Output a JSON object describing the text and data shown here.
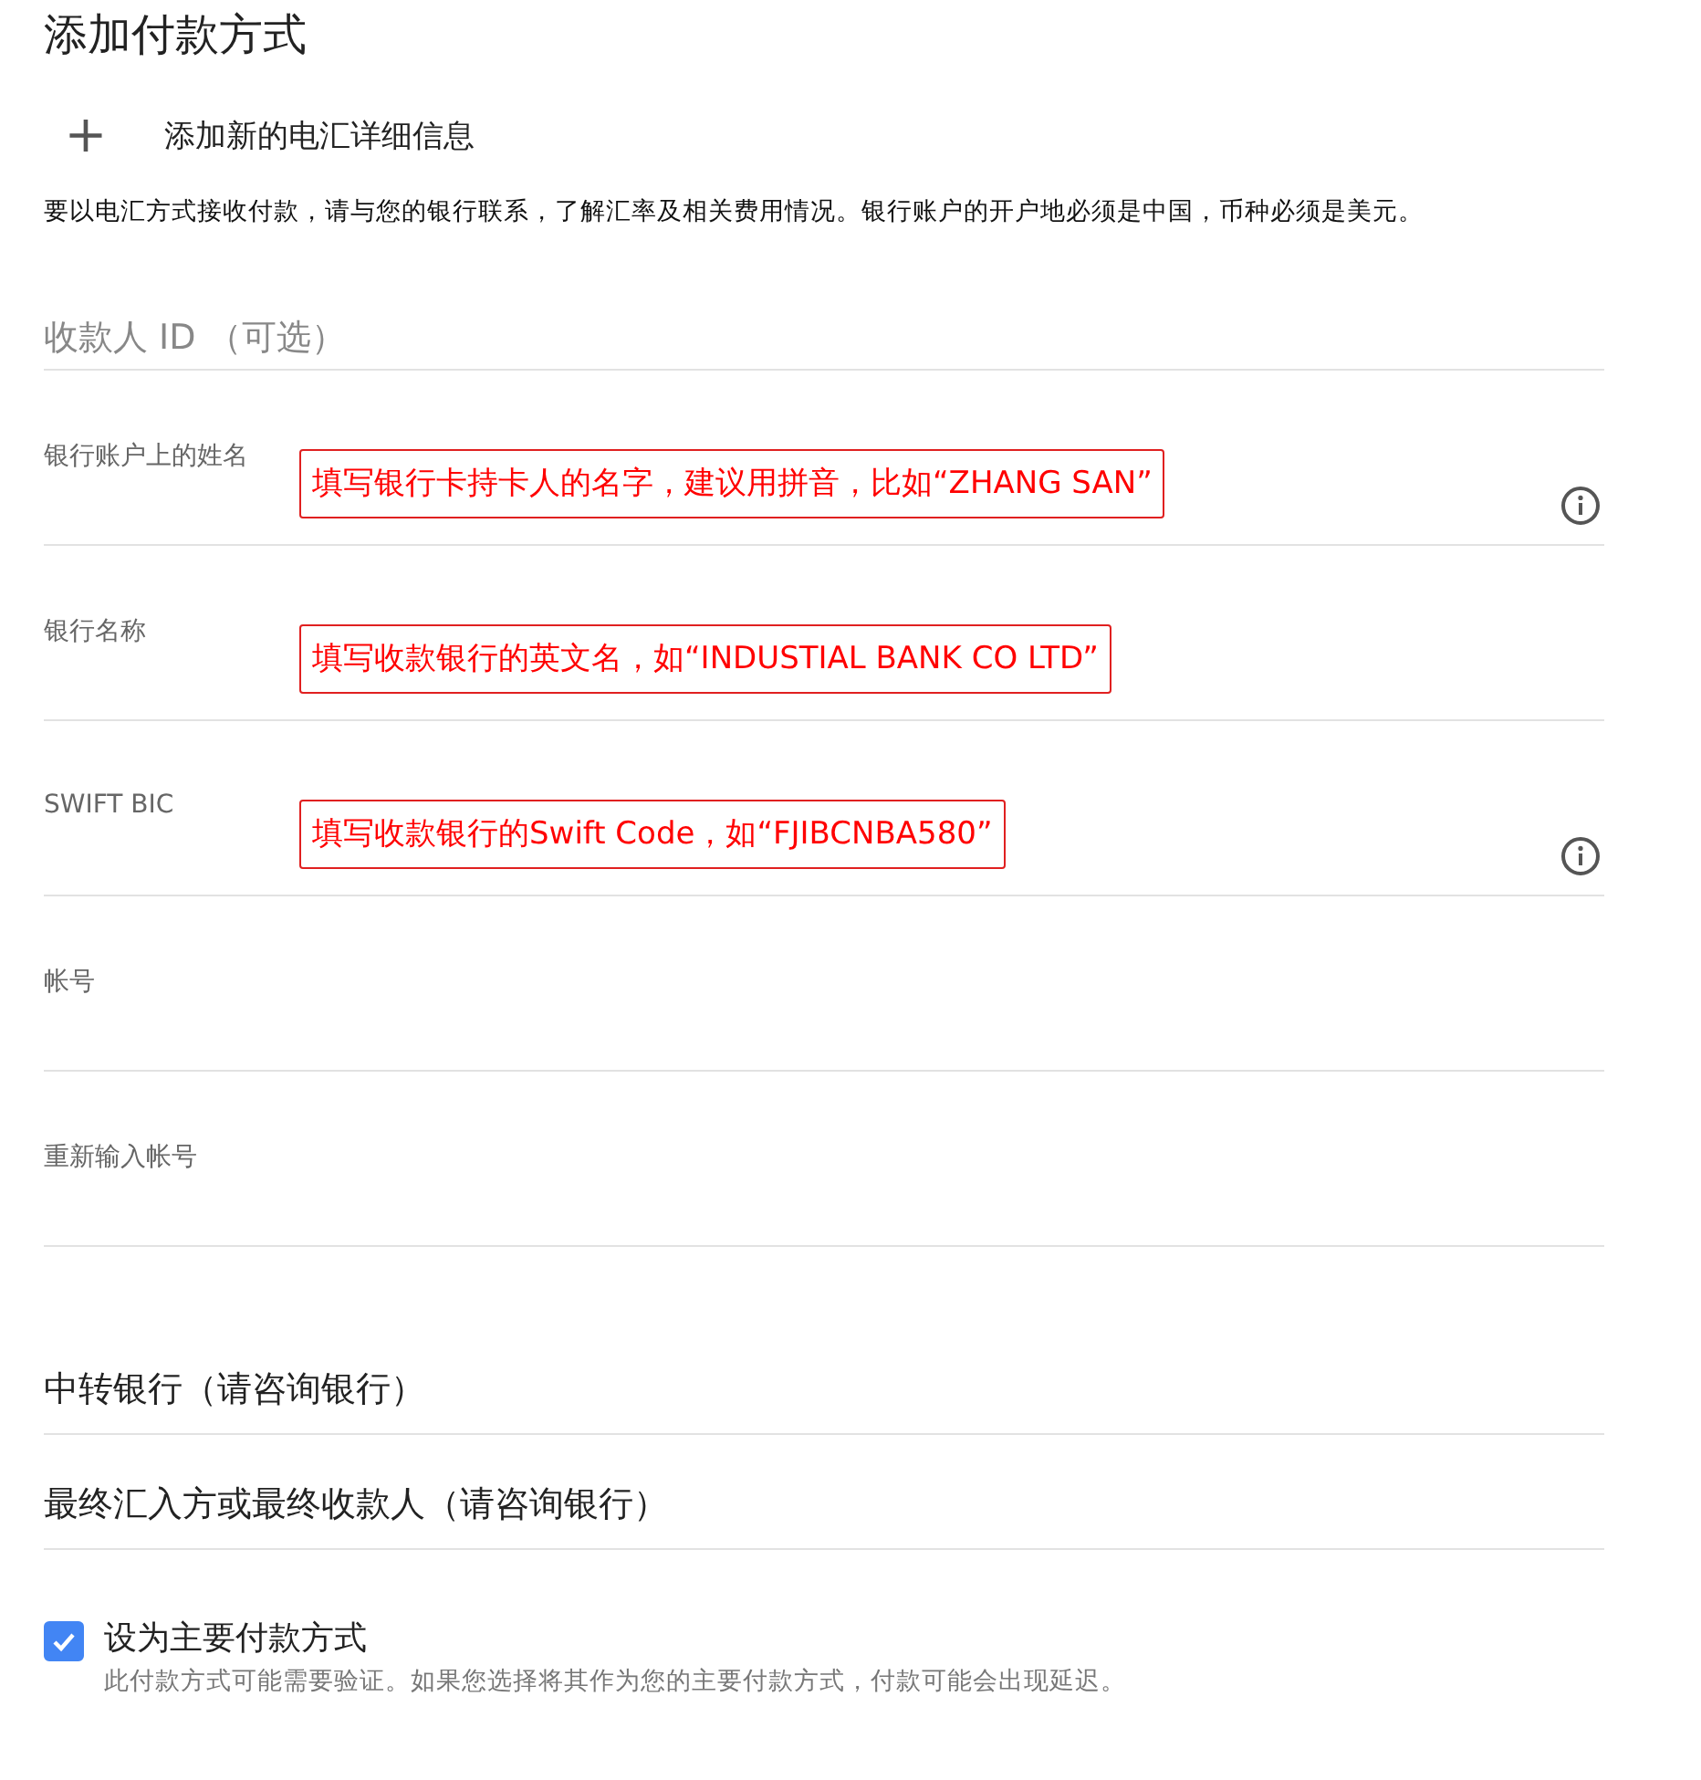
{
  "title": "添加付款方式",
  "add_action": {
    "icon": "+",
    "label": "添加新的电汇详细信息"
  },
  "description": "要以电汇方式接收付款，请与您的银行联系，了解汇率及相关费用情况。银行账户的开户地必须是中国，币种必须是美元。",
  "fields": [
    {
      "kind": "placeholder",
      "placeholder": "收款人 ID （可选）",
      "info": false
    },
    {
      "kind": "labeled",
      "label": "银行账户上的姓名",
      "info": true,
      "annotation": "填写银行卡持卡人的名字，建议用拼音，比如“ZHANG SAN”"
    },
    {
      "kind": "labeled",
      "label": "银行名称",
      "info": false,
      "annotation": "填写收款银行的英文名，如“INDUSTIAL BANK CO LTD”"
    },
    {
      "kind": "labeled",
      "label": "SWIFT BIC",
      "info": true,
      "annotation": "填写收款银行的Swift Code，如“FJIBCNBA580”"
    },
    {
      "kind": "labeled",
      "label": "帐号",
      "info": false
    },
    {
      "kind": "labeled",
      "label": "重新输入帐号",
      "info": false
    }
  ],
  "sections": [
    {
      "label": "中转银行（请咨询银行）"
    },
    {
      "label": "最终汇入方或最终收款人（请咨询银行）"
    }
  ],
  "primary": {
    "label": "设为主要付款方式",
    "checked": true,
    "hint": "此付款方式可能需要验证。如果您选择将其作为您的主要付款方式，付款可能会出现延迟。"
  }
}
